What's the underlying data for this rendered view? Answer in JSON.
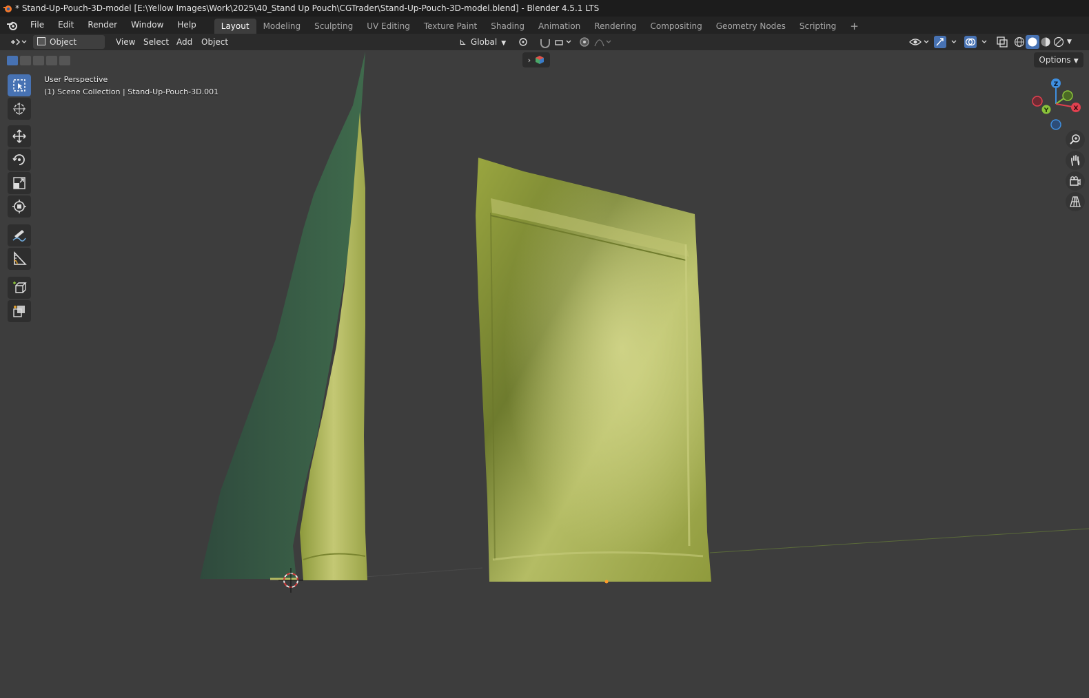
{
  "window": {
    "title": "* Stand-Up-Pouch-3D-model [E:\\Yellow Images\\Work\\2025\\40_Stand Up Pouch\\CGTrader\\Stand-Up-Pouch-3D-model.blend] - Blender 4.5.1 LTS"
  },
  "menu": {
    "items": [
      "File",
      "Edit",
      "Render",
      "Window",
      "Help"
    ]
  },
  "workspaces": {
    "tabs": [
      "Layout",
      "Modeling",
      "Sculpting",
      "UV Editing",
      "Texture Paint",
      "Shading",
      "Animation",
      "Rendering",
      "Compositing",
      "Geometry Nodes",
      "Scripting"
    ],
    "active": "Layout",
    "add_symbol": "+"
  },
  "header": {
    "mode": "Object Mode",
    "menus": [
      "View",
      "Select",
      "Add",
      "Object"
    ],
    "orientation": "Global",
    "options_label": "Options"
  },
  "viewport": {
    "view_name": "User Perspective",
    "collection_info": "(1) Scene Collection | Stand-Up-Pouch-3D.001",
    "gizmo_axes": [
      "Z",
      "Y",
      "X"
    ],
    "background_color": "#3d3d3d"
  },
  "colors": {
    "accent": "#4772b3",
    "axis_x": "#e2404f",
    "axis_y": "#8ac33a",
    "axis_z": "#3f8fe0",
    "pouch": "#a8b04a"
  },
  "icons": {
    "tools": [
      "select-box-icon",
      "cursor-icon",
      "move-icon",
      "rotate-icon",
      "scale-icon",
      "transform-icon",
      "annotate-icon",
      "measure-icon",
      "add-cube-icon",
      "cage-icon"
    ],
    "navigation": [
      "zoom-icon",
      "pan-hand-icon",
      "camera-icon",
      "grid-perspective-icon"
    ]
  }
}
